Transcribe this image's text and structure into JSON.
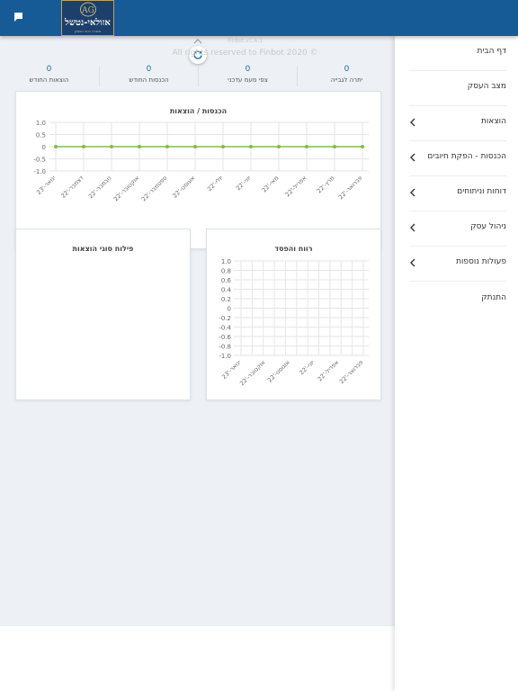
{
  "header": {
    "chat_icon": "message-square-icon",
    "logo": {
      "monogram": "AG",
      "name": "אזולאי-נטשל",
      "tagline": "משרד רואי חשבון"
    }
  },
  "sidebar": {
    "items": [
      {
        "label": "דף הבית",
        "has_submenu": false
      },
      {
        "label": "מצב העסק",
        "has_submenu": false
      },
      {
        "label": "הוצאות",
        "has_submenu": true
      },
      {
        "label": "הכנסות - הפקת חיובים",
        "has_submenu": true
      },
      {
        "label": "דוחות וניתוחים",
        "has_submenu": true
      },
      {
        "label": "ניהול עסק",
        "has_submenu": true
      },
      {
        "label": "פעולות נוספות",
        "has_submenu": true
      },
      {
        "label": "התנתק",
        "has_submenu": false
      }
    ]
  },
  "toolbar": {
    "collapse_icon": "chevron-up-icon",
    "refresh_icon": "refresh-icon"
  },
  "stats": [
    {
      "value": "0",
      "label": "יתרה לגבייה"
    },
    {
      "value": "0",
      "label": "צפי מעמ עדכני"
    },
    {
      "value": "0",
      "label": "הכנסות החודש"
    },
    {
      "value": "0",
      "label": "הוצאות החודש"
    }
  ],
  "colors": {
    "header_bg": "#165b96",
    "stat_value": "#1d6dac",
    "line_series": "#7dbf4a"
  },
  "chart_data": [
    {
      "type": "line",
      "title": "הכנסות / הוצאות",
      "categories": [
        "פברואר-'22",
        "מרץ-'22",
        "אפריל-'22",
        "מאי-'22",
        "יוני-'22",
        "יולי-'22",
        "אוגוסט-'22",
        "ספטמבר-'22",
        "אוקטובר-'22",
        "נובמבר-'22",
        "דצמבר-'22",
        "ינואר-'23"
      ],
      "series": [
        {
          "values": [
            0,
            0,
            0,
            0,
            0,
            0,
            0,
            0,
            0,
            0,
            0,
            0
          ]
        }
      ],
      "yticks": [
        "1.0",
        "0.5",
        "0",
        "-0.5",
        "-1.0"
      ],
      "ylim": [
        -1,
        1
      ],
      "grid": true
    },
    {
      "type": "line",
      "title": "רווח והפסד",
      "categories": [
        "פברואר-'22",
        "אפריל-'22",
        "יוני-'22",
        "אוגוסט-'22",
        "אוקטובר-'22",
        "ינואר-'23"
      ],
      "series": [],
      "yticks": [
        "1.0",
        "0.8",
        "0.6",
        "0.4",
        "0.2",
        "0",
        "-0.2",
        "-0.4",
        "-0.6",
        "-0.8",
        "-1.0"
      ],
      "ylim": [
        -1,
        1
      ],
      "grid": true
    },
    {
      "type": "pie",
      "title": "פילוח סוגי הוצאות",
      "values": []
    }
  ],
  "footer": {
    "version": "Finbot v1.6.1",
    "copyright": "All rights reserved to Finbot 2020 ©"
  }
}
